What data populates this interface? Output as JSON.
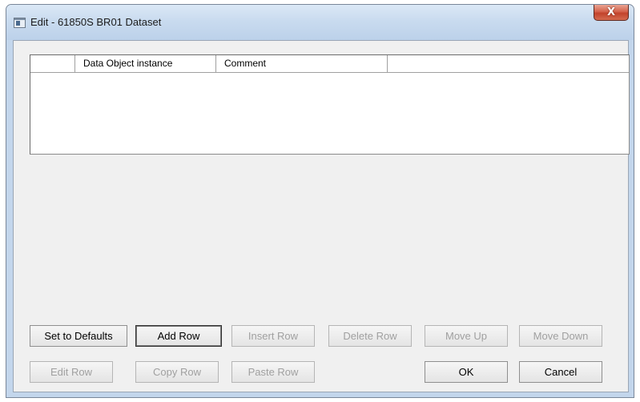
{
  "window": {
    "title": "Edit - 61850S BR01 Dataset",
    "close_label": "X"
  },
  "grid": {
    "columns": [
      "",
      "Data Object instance",
      "Comment",
      ""
    ],
    "rows": []
  },
  "buttons": {
    "set_defaults": "Set to Defaults",
    "add_row": "Add Row",
    "insert_row": "Insert Row",
    "delete_row": "Delete Row",
    "move_up": "Move Up",
    "move_down": "Move Down",
    "edit_row": "Edit Row",
    "copy_row": "Copy Row",
    "paste_row": "Paste Row",
    "ok": "OK",
    "cancel": "Cancel"
  },
  "colors": {
    "title_bar": "#c9dbef",
    "close_button": "#c2432c",
    "dialog_background": "#f0f0f0",
    "disabled_text": "#a0a0a0"
  }
}
